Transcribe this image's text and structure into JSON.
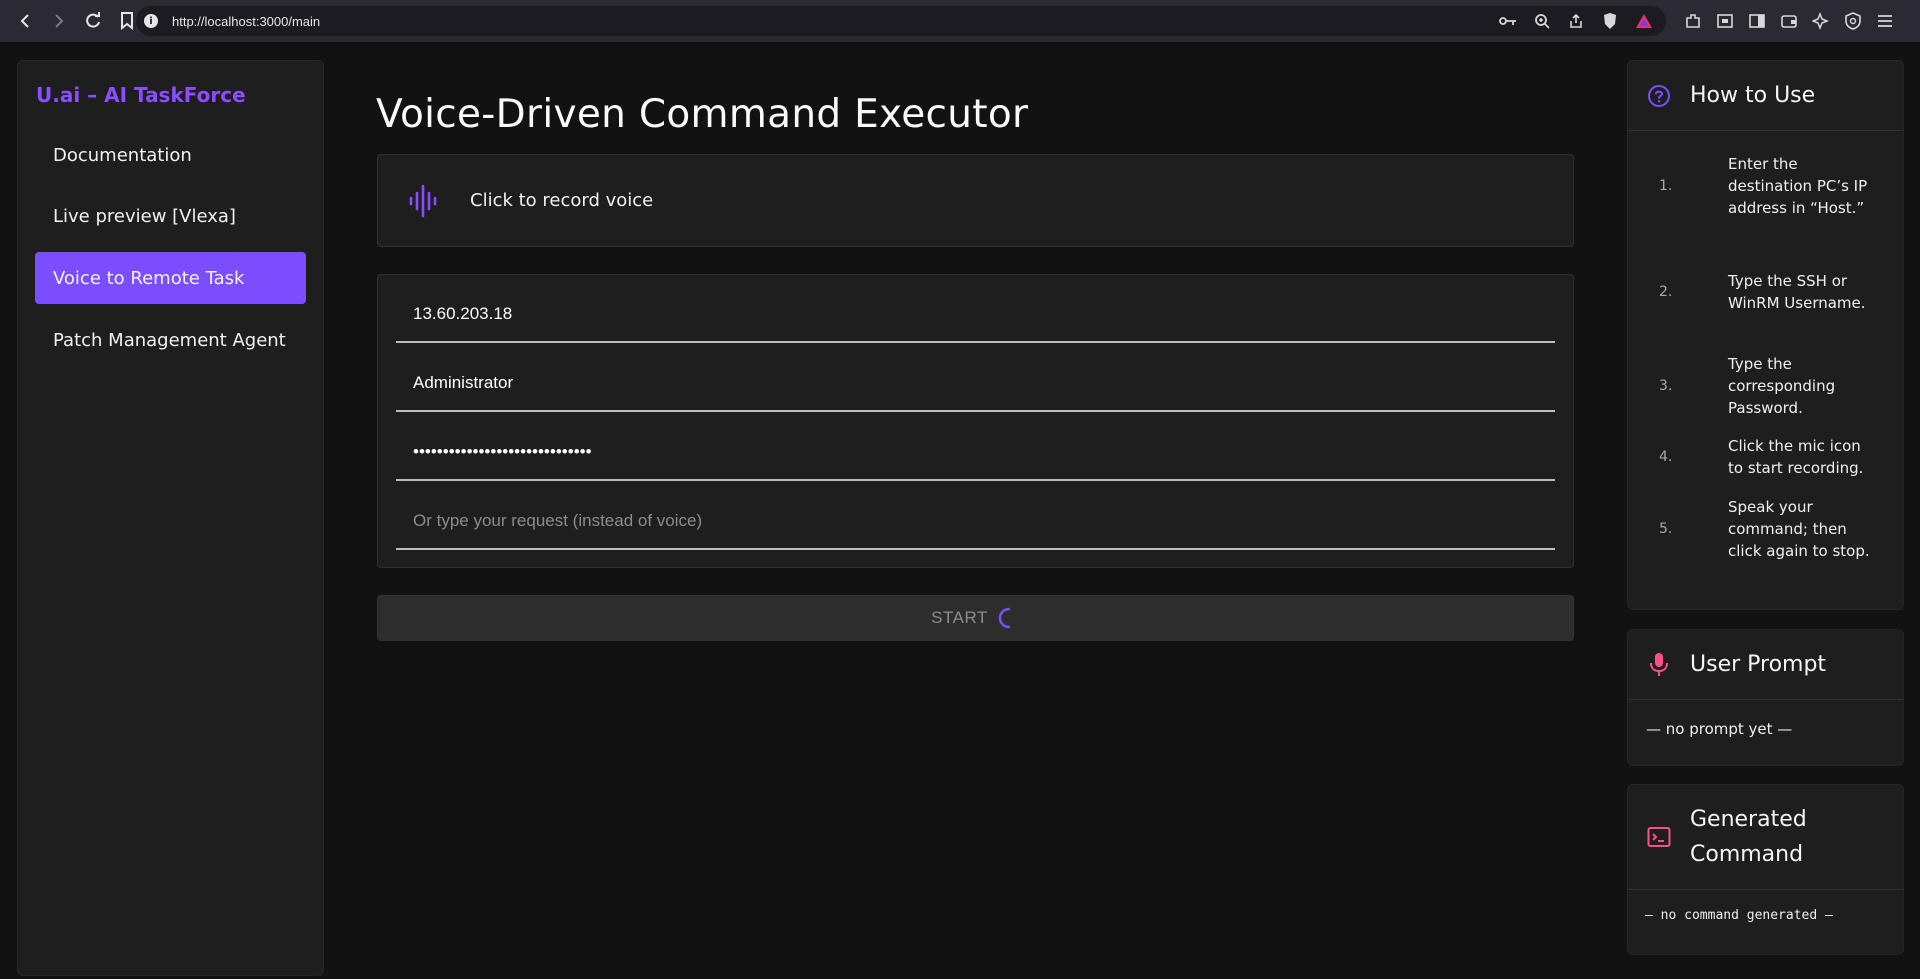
{
  "browser": {
    "url": "http://localhost:3000/main"
  },
  "sidebar": {
    "brand": "U.ai – AI TaskForce",
    "items": [
      {
        "label": "Documentation"
      },
      {
        "label": "Live preview [Vlexa]"
      },
      {
        "label": "Voice to Remote Task",
        "active": true
      },
      {
        "label": "Patch Management Agent"
      }
    ]
  },
  "main": {
    "title": "Voice-Driven Command Executor",
    "record_label": "Click to record voice",
    "host_value": "13.60.203.18",
    "username_value": "Administrator",
    "password_value": "••••••••••••••••••••••••••••••",
    "request_placeholder": "Or type your request (instead of voice)",
    "start_label": "START"
  },
  "howto": {
    "title": "How to Use",
    "steps": [
      {
        "num": "1.",
        "text": "Enter the destination PC’s IP address in “Host.”"
      },
      {
        "num": "2.",
        "text": "Type the SSH or WinRM Username."
      },
      {
        "num": "3.",
        "text": "Type the corresponding Password."
      },
      {
        "num": "4.",
        "text": "Click the mic icon to start recording."
      },
      {
        "num": "5.",
        "text": "Speak your command; then click again to stop."
      }
    ]
  },
  "user_prompt": {
    "title": "User Prompt",
    "body": "— no prompt yet —"
  },
  "generated": {
    "title": "Generated Command",
    "body": "— no command generated —"
  },
  "colors": {
    "accent": "#7c4dff",
    "brand": "#8a4dff",
    "pink": "#ff4f8b",
    "background": "#121212",
    "card": "#1e1e1e"
  }
}
